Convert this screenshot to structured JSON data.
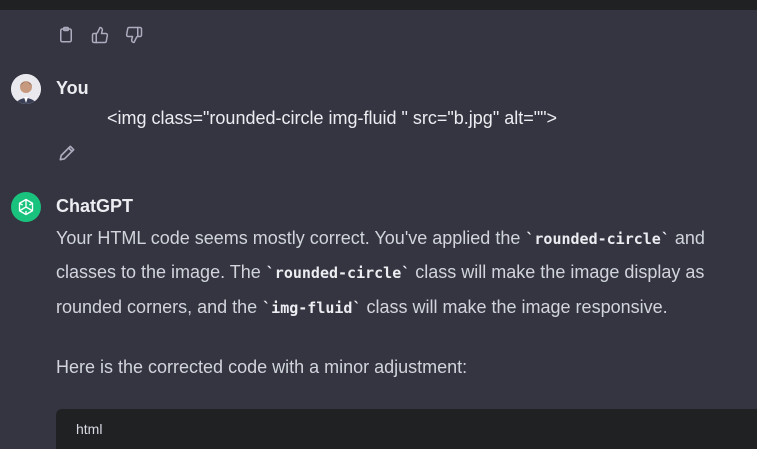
{
  "prev_message_actions": {
    "copy_icon": "clipboard-icon",
    "like_icon": "thumbs-up-icon",
    "dislike_icon": "thumbs-down-icon"
  },
  "user_message": {
    "author": "You",
    "text": "<img class=\"rounded-circle img-fluid \" src=\"b.jpg\"  alt=\"\">",
    "edit_icon": "pencil-icon"
  },
  "assistant_message": {
    "author": "ChatGPT",
    "line1_prefix": "Your HTML code seems mostly correct. You've applied the ",
    "line1_code": "`rounded-circle`",
    "line1_suffix": " and ",
    "line2_prefix": "classes to the image. The ",
    "line2_code": "`rounded-circle`",
    "line2_suffix": " class will make the image display as",
    "line3_prefix": "rounded corners, and the ",
    "line3_code": "`img-fluid`",
    "line3_suffix": " class will make the image responsive.",
    "para2": "Here is the corrected code with a minor adjustment:",
    "code_lang": "html"
  },
  "colors": {
    "background": "#343541",
    "assistant_avatar": "#19c37d",
    "code_header": "#202123"
  }
}
